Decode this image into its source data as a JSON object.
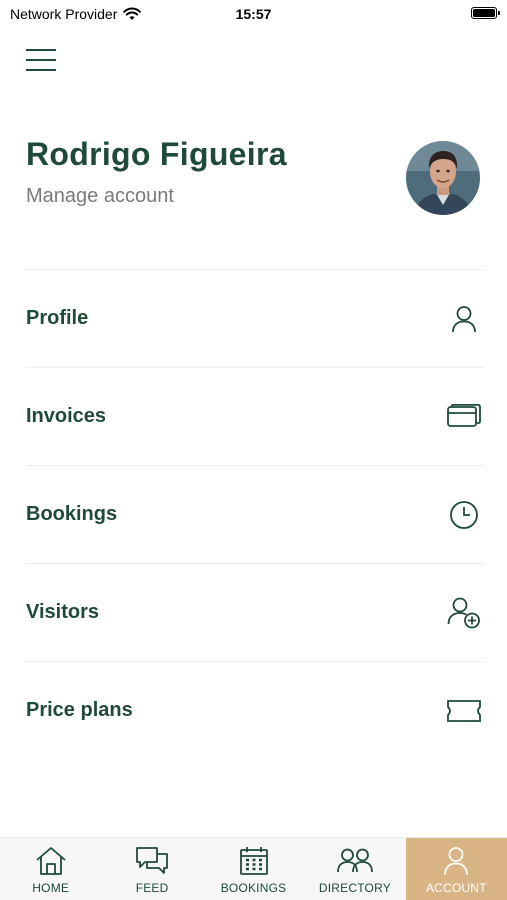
{
  "status_bar": {
    "carrier": "Network Provider",
    "time": "15:57"
  },
  "header": {
    "name": "Rodrigo Figueira",
    "subtitle": "Manage account"
  },
  "menu": [
    {
      "label": "Profile",
      "icon": "person-icon"
    },
    {
      "label": "Invoices",
      "icon": "cards-icon"
    },
    {
      "label": "Bookings",
      "icon": "clock-icon"
    },
    {
      "label": "Visitors",
      "icon": "add-person-icon"
    },
    {
      "label": "Price plans",
      "icon": "ticket-icon"
    }
  ],
  "tab_bar": {
    "tabs": [
      {
        "label": "HOME",
        "icon": "home-icon"
      },
      {
        "label": "FEED",
        "icon": "chat-icon"
      },
      {
        "label": "BOOKINGS",
        "icon": "calendar-icon"
      },
      {
        "label": "DIRECTORY",
        "icon": "people-icon"
      },
      {
        "label": "ACCOUNT",
        "icon": "person-icon"
      }
    ],
    "active": "ACCOUNT"
  },
  "colors": {
    "primary": "#1f4a38",
    "accent": "#d9b585",
    "muted": "#7a7a7a"
  }
}
